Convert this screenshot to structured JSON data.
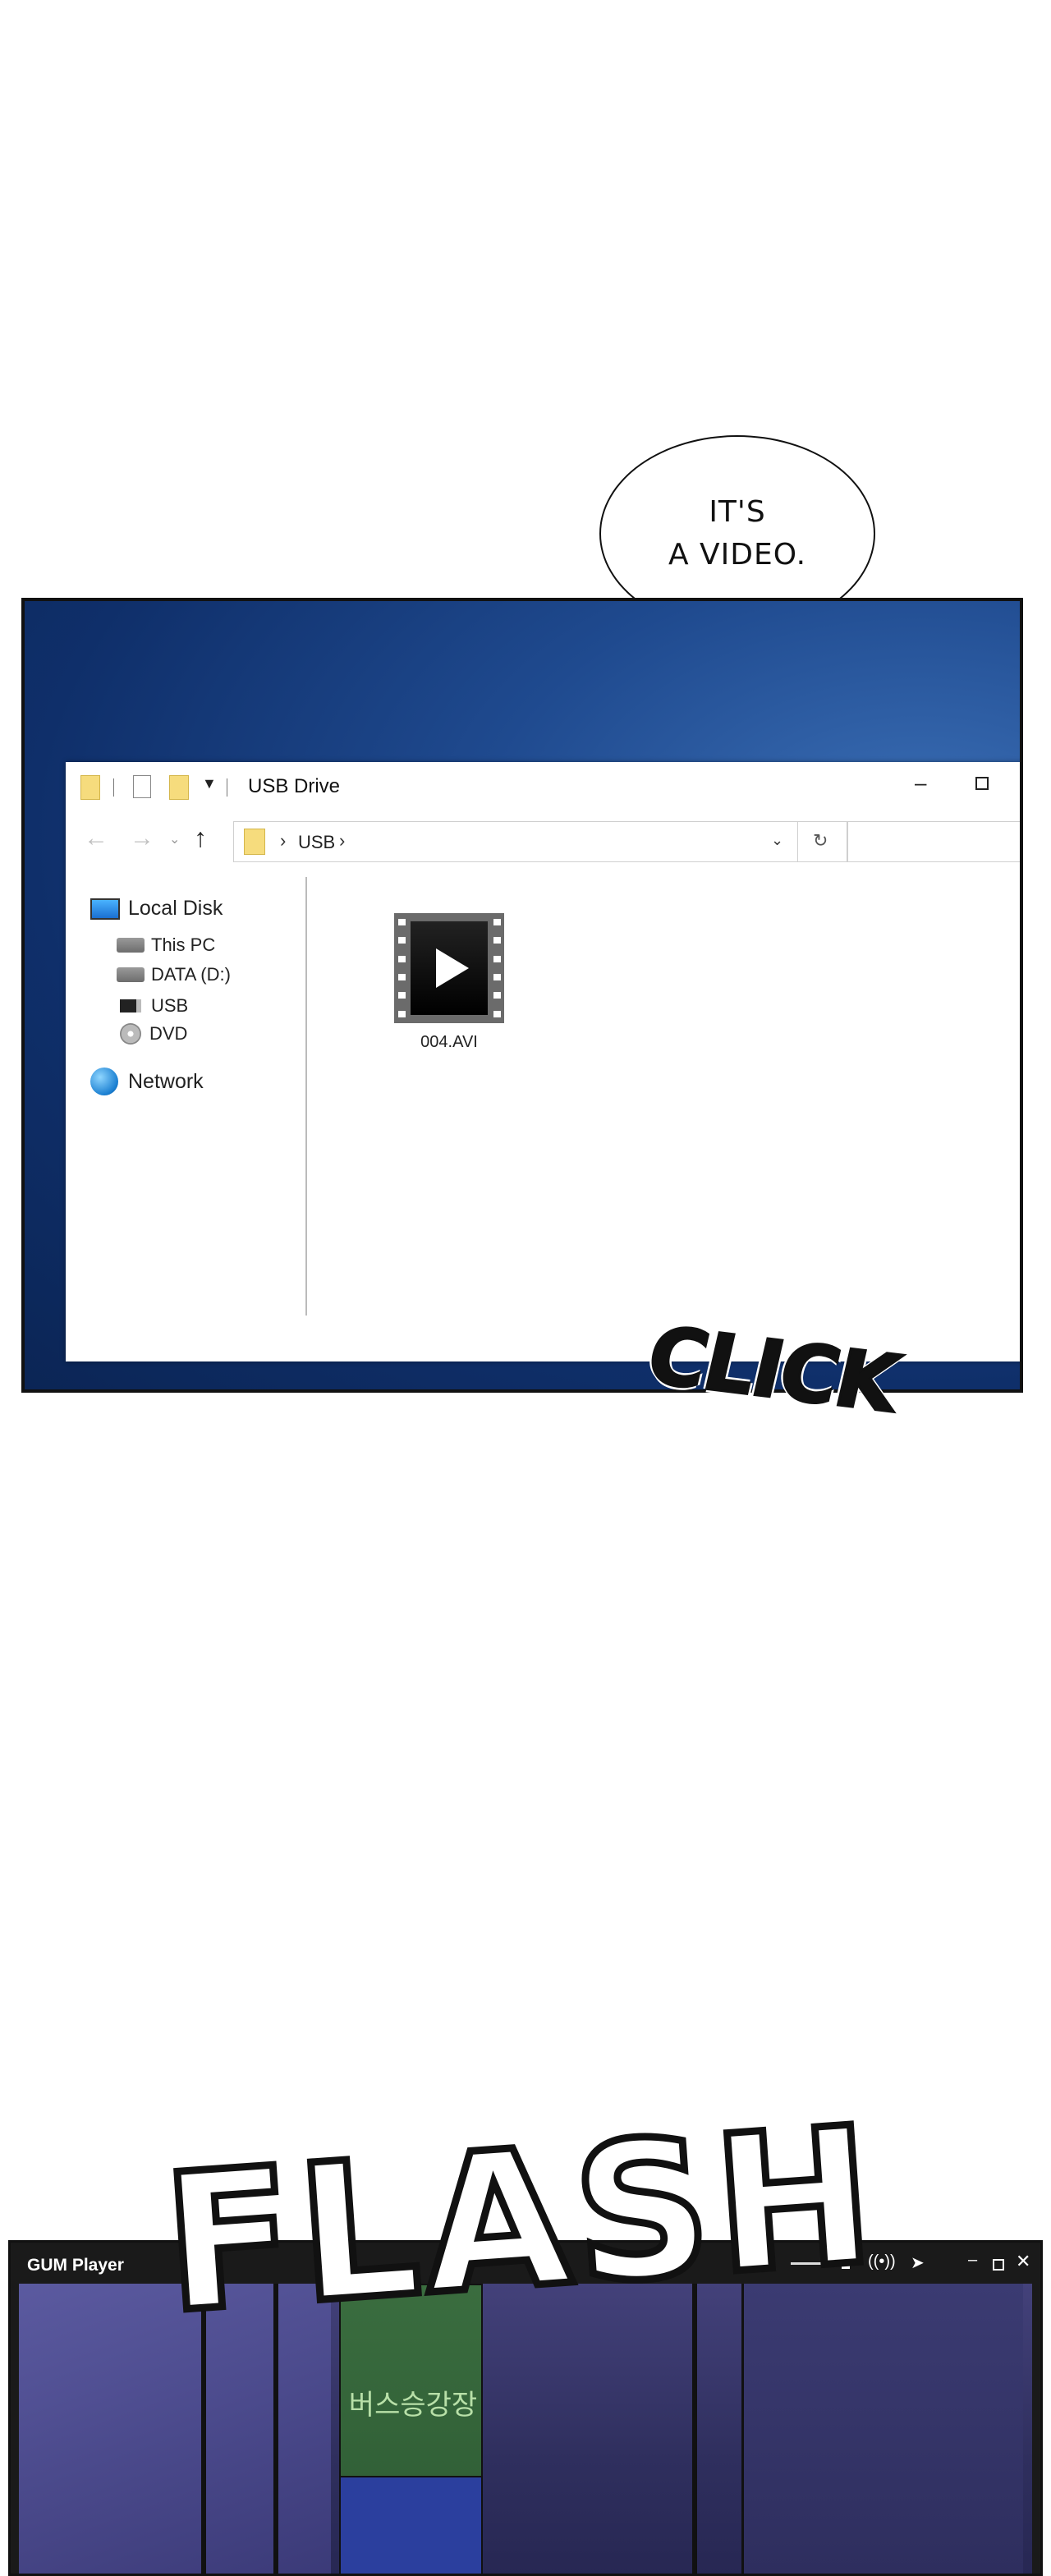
{
  "bubble": {
    "line1": "IT'S",
    "line2": "A VIDEO."
  },
  "explorer": {
    "title": "USB Drive",
    "address_path": "USB",
    "nav_tree": [
      {
        "label": "Local Disk",
        "icon": "computer-icon"
      },
      {
        "label": "This PC",
        "icon": "drive-icon"
      },
      {
        "label": "DATA (D:)",
        "icon": "drive-icon"
      },
      {
        "label": "USB",
        "icon": "usb-drive-icon"
      },
      {
        "label": "DVD",
        "icon": "dvd-icon"
      },
      {
        "label": "Network",
        "icon": "network-icon"
      }
    ],
    "file": {
      "name": "004.AVI",
      "icon": "video-file-icon"
    }
  },
  "sfx": {
    "click": "CLICK",
    "flash": "FLASH"
  },
  "player": {
    "title": "GUM Player",
    "sign_text": "버스승강장"
  },
  "colors": {
    "desktop_blue": "#1f4a8f",
    "folder_yellow": "#f6dc7d"
  }
}
